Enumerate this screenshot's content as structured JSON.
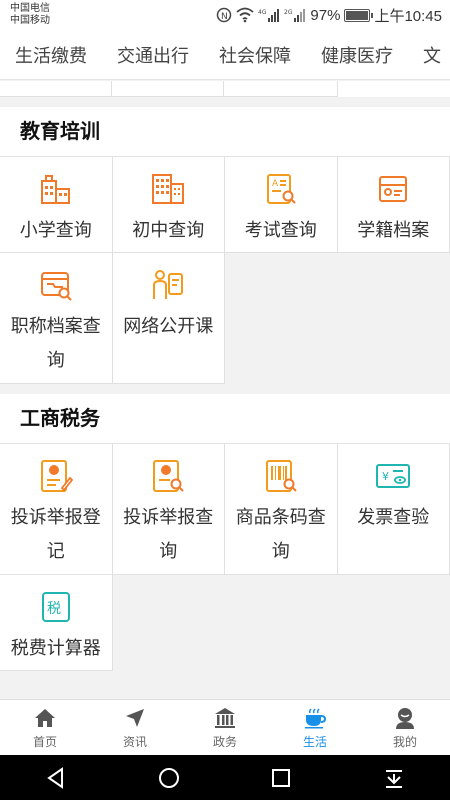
{
  "status": {
    "carrier1": "中国电信",
    "carrier2": "中国移动",
    "battery": "97%",
    "battery_level": 0.97,
    "time": "上午10:45"
  },
  "tabs": [
    "生活缴费",
    "交通出行",
    "社会保障",
    "健康医疗",
    "文"
  ],
  "sections": {
    "education": {
      "title": "教育培训",
      "items": [
        "小学查询",
        "初中查询",
        "考试查询",
        "学籍档案",
        "职称档案查询",
        "网络公开课"
      ]
    },
    "business": {
      "title": "工商税务",
      "items": [
        "投诉举报登记",
        "投诉举报查询",
        "商品条码查询",
        "发票查验",
        "税费计算器"
      ]
    }
  },
  "bottom_nav": [
    "首页",
    "资讯",
    "政务",
    "生活",
    "我的"
  ],
  "colors": {
    "accent": "#1890e8",
    "icon_orange": "#f07a2a",
    "icon_teal": "#1fb5b0"
  }
}
